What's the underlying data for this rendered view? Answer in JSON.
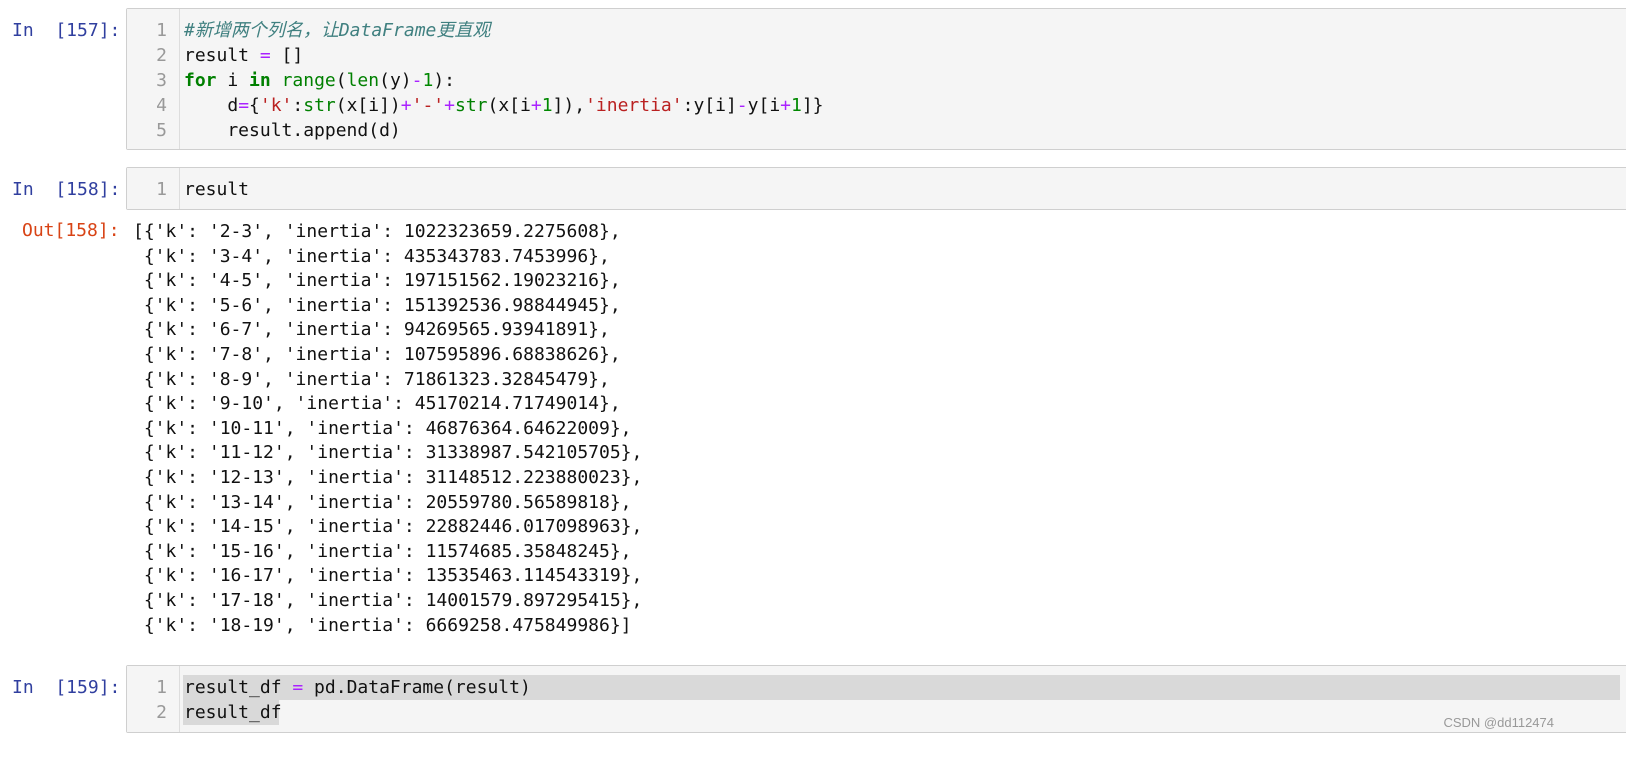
{
  "cells": [
    {
      "prompt": "In  [157]:",
      "lines": [
        {
          "n": "1",
          "parts": [
            {
              "t": "#新增两个列名，让DataFrame更直观",
              "c": "cm-comment"
            }
          ]
        },
        {
          "n": "2",
          "parts": [
            {
              "t": "result ",
              "c": "cm-var"
            },
            {
              "t": "=",
              "c": "cm-op"
            },
            {
              "t": " []",
              "c": "cm-var"
            }
          ]
        },
        {
          "n": "3",
          "parts": [
            {
              "t": "for",
              "c": "cm-kw"
            },
            {
              "t": " i ",
              "c": "cm-var"
            },
            {
              "t": "in",
              "c": "cm-kw"
            },
            {
              "t": " ",
              "c": "cm-var"
            },
            {
              "t": "range",
              "c": "cm-builtin"
            },
            {
              "t": "(",
              "c": "cm-var"
            },
            {
              "t": "len",
              "c": "cm-builtin"
            },
            {
              "t": "(y)",
              "c": "cm-var"
            },
            {
              "t": "-",
              "c": "cm-op"
            },
            {
              "t": "1",
              "c": "cm-num"
            },
            {
              "t": "):",
              "c": "cm-var"
            }
          ]
        },
        {
          "n": "4",
          "parts": [
            {
              "t": "    d",
              "c": "cm-var"
            },
            {
              "t": "=",
              "c": "cm-op"
            },
            {
              "t": "{",
              "c": "cm-var"
            },
            {
              "t": "'k'",
              "c": "cm-str"
            },
            {
              "t": ":",
              "c": "cm-var"
            },
            {
              "t": "str",
              "c": "cm-builtin"
            },
            {
              "t": "(x[i])",
              "c": "cm-var"
            },
            {
              "t": "+",
              "c": "cm-op"
            },
            {
              "t": "'-'",
              "c": "cm-str"
            },
            {
              "t": "+",
              "c": "cm-op"
            },
            {
              "t": "str",
              "c": "cm-builtin"
            },
            {
              "t": "(x[i",
              "c": "cm-var"
            },
            {
              "t": "+",
              "c": "cm-op"
            },
            {
              "t": "1",
              "c": "cm-num"
            },
            {
              "t": "]),",
              "c": "cm-var"
            },
            {
              "t": "'inertia'",
              "c": "cm-str"
            },
            {
              "t": ":y[i]",
              "c": "cm-var"
            },
            {
              "t": "-",
              "c": "cm-op"
            },
            {
              "t": "y[i",
              "c": "cm-var"
            },
            {
              "t": "+",
              "c": "cm-op"
            },
            {
              "t": "1",
              "c": "cm-num"
            },
            {
              "t": "]}",
              "c": "cm-var"
            }
          ]
        },
        {
          "n": "5",
          "parts": [
            {
              "t": "    result.append(d)",
              "c": "cm-var"
            }
          ]
        }
      ]
    },
    {
      "prompt": "In  [158]:",
      "lines": [
        {
          "n": "1",
          "parts": [
            {
              "t": "result",
              "c": "cm-var"
            }
          ]
        }
      ],
      "out_prompt": "Out[158]:",
      "output": [
        "[{'k': '2-3', 'inertia': 1022323659.2275608},",
        " {'k': '3-4', 'inertia': 435343783.7453996},",
        " {'k': '4-5', 'inertia': 197151562.19023216},",
        " {'k': '5-6', 'inertia': 151392536.98844945},",
        " {'k': '6-7', 'inertia': 94269565.93941891},",
        " {'k': '7-8', 'inertia': 107595896.68838626},",
        " {'k': '8-9', 'inertia': 71861323.32845479},",
        " {'k': '9-10', 'inertia': 45170214.71749014},",
        " {'k': '10-11', 'inertia': 46876364.64622009},",
        " {'k': '11-12', 'inertia': 31338987.542105705},",
        " {'k': '12-13', 'inertia': 31148512.223880023},",
        " {'k': '13-14', 'inertia': 20559780.56589818},",
        " {'k': '14-15', 'inertia': 22882446.017098963},",
        " {'k': '15-16', 'inertia': 11574685.35848245},",
        " {'k': '16-17', 'inertia': 13535463.114543319},",
        " {'k': '17-18', 'inertia': 14001579.897295415},",
        " {'k': '18-19', 'inertia': 6669258.475849986}]"
      ]
    },
    {
      "prompt": "In  [159]:",
      "lines": [
        {
          "n": "1",
          "parts": [
            {
              "t": "result_df ",
              "c": "cm-var"
            },
            {
              "t": "=",
              "c": "cm-op"
            },
            {
              "t": " pd.DataFrame(result)",
              "c": "cm-var"
            }
          ]
        },
        {
          "n": "2",
          "parts": [
            {
              "t": "result_df",
              "c": "cm-var"
            }
          ]
        }
      ]
    }
  ],
  "watermark": "CSDN @dd112474"
}
